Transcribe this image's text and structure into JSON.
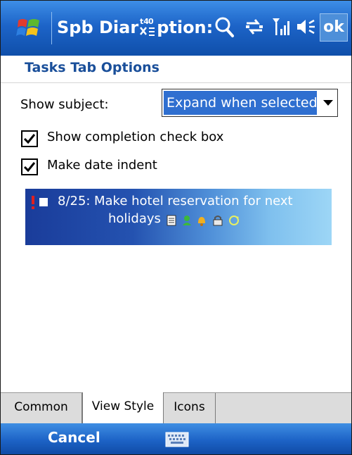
{
  "titlebar": {
    "title": "Spb Diar",
    "title_suffix": "ption:",
    "ok_label": "ok"
  },
  "header": {
    "title": "Tasks Tab Options"
  },
  "form": {
    "show_subject_label": "Show subject:",
    "show_subject_value": "Expand when selected",
    "show_completion_label": "Show completion check box",
    "show_completion_checked": true,
    "date_indent_label": "Make date indent",
    "date_indent_checked": true
  },
  "preview": {
    "date": "8/25:",
    "text_line1": "Make hotel reservation for next",
    "text_line2": "holidays"
  },
  "tabs": [
    {
      "label": "Common",
      "active": false
    },
    {
      "label": "View Style",
      "active": true
    },
    {
      "label": "Icons",
      "active": false
    }
  ],
  "bottombar": {
    "cancel_label": "Cancel"
  },
  "colors": {
    "titlebar": "#1d64c8",
    "header_text": "#1a4f9a",
    "selection": "#2f6fd0"
  }
}
